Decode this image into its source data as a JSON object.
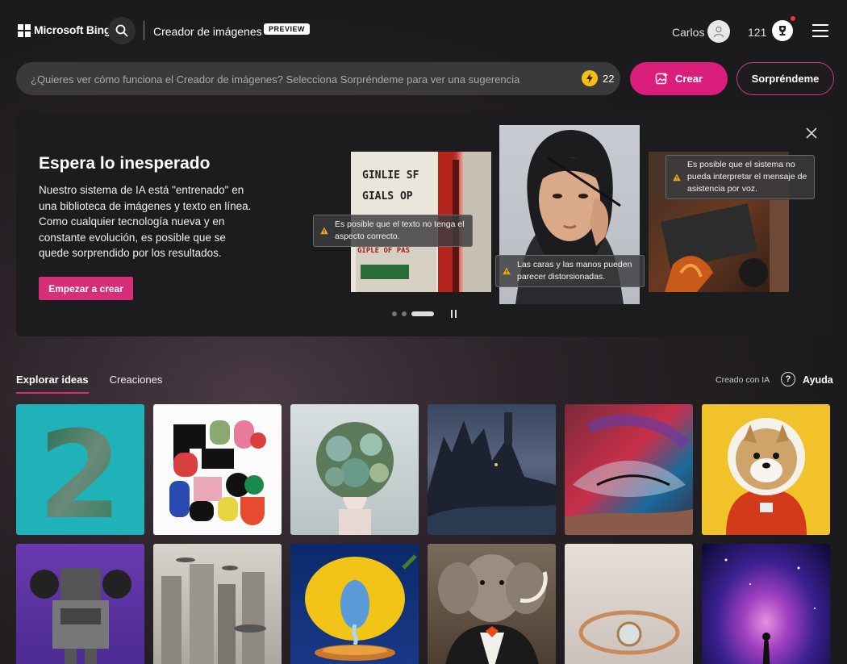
{
  "header": {
    "brand": "Microsoft Bing",
    "product": "Creador de imágenes",
    "badge": "PREVIEW",
    "user_name": "Carlos",
    "points": "121",
    "icons": [
      "microsoft-logo-icon",
      "search-icon",
      "user-avatar-icon",
      "rewards-trophy-icon",
      "hamburger-menu-icon"
    ]
  },
  "prompt": {
    "placeholder": "¿Quieres ver cómo funciona el Creador de imágenes? Selecciona Sorpréndeme para ver una sugerencia",
    "boosts": "22",
    "create_label": "Crear",
    "surprise_label": "Sorpréndeme"
  },
  "hero": {
    "title": "Espera lo inesperado",
    "body": "Nuestro sistema de IA está \"entrenado\" en una biblioteca de imágenes y texto en línea. Como cualquier tecnología nueva y en constante evolución, es posible que se quede sorprendido por los resultados.",
    "cta": "Empezar a crear",
    "tips": [
      "Es posible que el texto no tenga el aspecto correcto.",
      "Las caras y las manos pueden parecer distorsionadas.",
      "Es posible que el sistema no pueda interpretar el mensaje de asistencia por voz."
    ],
    "sign_text": [
      "GINLIE SF",
      "GIALS OP",
      "GIPLE OF PAS"
    ],
    "carousel": {
      "slides": 3,
      "active": 2
    }
  },
  "tabs": {
    "explore": "Explorar ideas",
    "creations": "Creaciones",
    "ai_note": "Creado con IA",
    "help": "Ayuda"
  },
  "gallery_big_text": "2",
  "colors": {
    "accent": "#d91f7b",
    "background": "#1b1a1c",
    "prompt_bg": "#3a393c",
    "warning": "#f2a818"
  }
}
